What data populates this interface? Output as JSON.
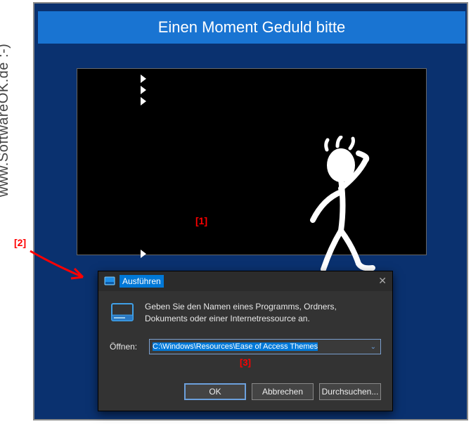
{
  "banner": {
    "title": "Einen Moment Geduld bitte"
  },
  "markers": {
    "m1": "[1]",
    "m2": "[2]",
    "m3": "[3]"
  },
  "dialog": {
    "title": "Ausführen",
    "instruction": "Geben Sie den Namen eines Programms, Ordners, Dokuments oder einer Internetressource an.",
    "open_label": "Öffnen:",
    "open_value": "C:\\Windows\\Resources\\Ease of Access Themes",
    "ok": "OK",
    "cancel": "Abbrechen",
    "browse": "Durchsuchen..."
  },
  "watermark": "www.SoftwareOK.de :-)"
}
